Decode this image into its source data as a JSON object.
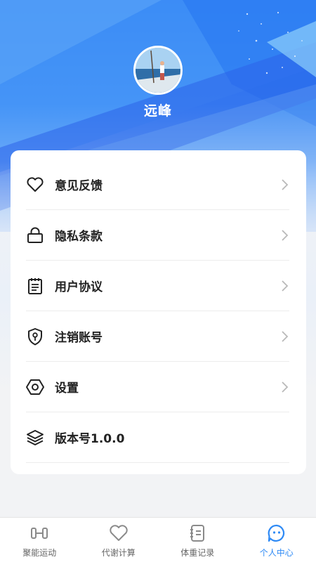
{
  "profile": {
    "username": "远峰",
    "avatar_alt": "avatar-photo"
  },
  "menu": {
    "items": [
      {
        "label": "意见反馈",
        "icon": "heart-icon",
        "has_chevron": true
      },
      {
        "label": "隐私条款",
        "icon": "lock-icon",
        "has_chevron": true
      },
      {
        "label": "用户协议",
        "icon": "notepad-icon",
        "has_chevron": true
      },
      {
        "label": "注销账号",
        "icon": "shield-key-icon",
        "has_chevron": true
      },
      {
        "label": "设置",
        "icon": "hexagon-settings-icon",
        "has_chevron": true
      },
      {
        "label": "版本号1.0.0",
        "icon": "layers-icon",
        "has_chevron": false
      }
    ]
  },
  "tabbar": {
    "tabs": [
      {
        "label": "聚能运动",
        "icon": "dumbbell-icon",
        "active": false
      },
      {
        "label": "代谢计算",
        "icon": "heart-icon",
        "active": false
      },
      {
        "label": "体重记录",
        "icon": "notebook-icon",
        "active": false
      },
      {
        "label": "个人中心",
        "icon": "face-icon",
        "active": true
      }
    ]
  },
  "colors": {
    "accent": "#2e8af5",
    "hero_top": "#2a7df3",
    "text": "#222222",
    "muted": "#666666"
  }
}
